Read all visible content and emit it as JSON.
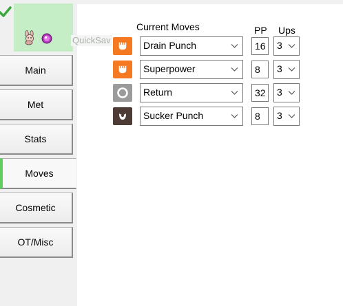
{
  "preview": {
    "sprite_icon": "pokemon-sprite-icon",
    "ball_icon": "pokeball-icon",
    "quicksave_label": "QuickSav"
  },
  "tabs": [
    {
      "label": "Main",
      "active": false
    },
    {
      "label": "Met",
      "active": false
    },
    {
      "label": "Stats",
      "active": false
    },
    {
      "label": "Moves",
      "active": true
    },
    {
      "label": "Cosmetic",
      "active": false
    },
    {
      "label": "OT/Misc",
      "active": false
    }
  ],
  "moves_panel": {
    "header_moves": "Current Moves",
    "header_pp": "PP",
    "header_ups": "Ups",
    "moves": [
      {
        "type_icon": "fighting-type-icon",
        "type_color": "#f47920",
        "name": "Drain Punch",
        "pp": "16",
        "ups": "3"
      },
      {
        "type_icon": "fighting-type-icon",
        "type_color": "#f47920",
        "name": "Superpower",
        "pp": "8",
        "ups": "3"
      },
      {
        "type_icon": "normal-type-icon",
        "type_color": "#9b9b9b",
        "name": "Return",
        "pp": "32",
        "ups": "3"
      },
      {
        "type_icon": "dark-type-icon",
        "type_color": "#4d3b35",
        "name": "Sucker Punch",
        "pp": "8",
        "ups": "3"
      }
    ]
  },
  "colors": {
    "active_tab_accent": "#5ece5e",
    "check_green": "#3aa83a",
    "preview_bg": "#c6eec6"
  }
}
